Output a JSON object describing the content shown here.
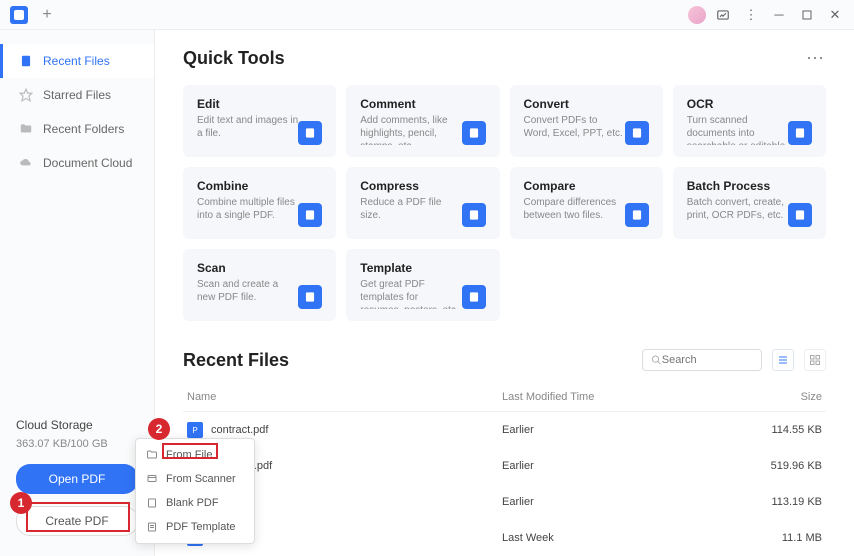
{
  "titlebar": {
    "new_tab": "+"
  },
  "sidebar": {
    "items": [
      {
        "label": "Recent Files"
      },
      {
        "label": "Starred Files"
      },
      {
        "label": "Recent Folders"
      },
      {
        "label": "Document Cloud"
      }
    ],
    "cloud_storage": {
      "title": "Cloud Storage",
      "value": "363.07 KB/100 GB"
    },
    "open_pdf": "Open PDF",
    "create_pdf": "Create PDF"
  },
  "main": {
    "quick_tools_title": "Quick Tools",
    "tools": [
      {
        "title": "Edit",
        "desc": "Edit text and images in a file."
      },
      {
        "title": "Comment",
        "desc": "Add comments, like highlights, pencil, stamps, etc."
      },
      {
        "title": "Convert",
        "desc": "Convert PDFs to Word, Excel, PPT, etc."
      },
      {
        "title": "OCR",
        "desc": "Turn scanned documents into searchable or editable ..."
      },
      {
        "title": "Combine",
        "desc": "Combine multiple files into a single PDF."
      },
      {
        "title": "Compress",
        "desc": "Reduce a PDF file size."
      },
      {
        "title": "Compare",
        "desc": "Compare differences between two files."
      },
      {
        "title": "Batch Process",
        "desc": "Batch convert, create, print, OCR PDFs, etc."
      },
      {
        "title": "Scan",
        "desc": "Scan and create a new PDF file."
      },
      {
        "title": "Template",
        "desc": "Get great PDF templates for resumes, posters, etc."
      }
    ],
    "recent_files_title": "Recent Files",
    "search_placeholder": "Search",
    "columns": {
      "name": "Name",
      "modified": "Last Modified Time",
      "size": "Size"
    },
    "files": [
      {
        "name": "contract.pdf",
        "modified": "Earlier",
        "size": "114.55 KB"
      },
      {
        "name": "Architect.pdf",
        "modified": "Earlier",
        "size": "519.96 KB"
      },
      {
        "name": "",
        "modified": "Earlier",
        "size": "113.19 KB"
      },
      {
        "name": "",
        "modified": "Last Week",
        "size": "11.1 MB"
      }
    ]
  },
  "context_menu": {
    "items": [
      {
        "label": "From File"
      },
      {
        "label": "From Scanner"
      },
      {
        "label": "Blank PDF"
      },
      {
        "label": "PDF Template"
      }
    ]
  },
  "annotations": {
    "1": "1",
    "2": "2"
  }
}
